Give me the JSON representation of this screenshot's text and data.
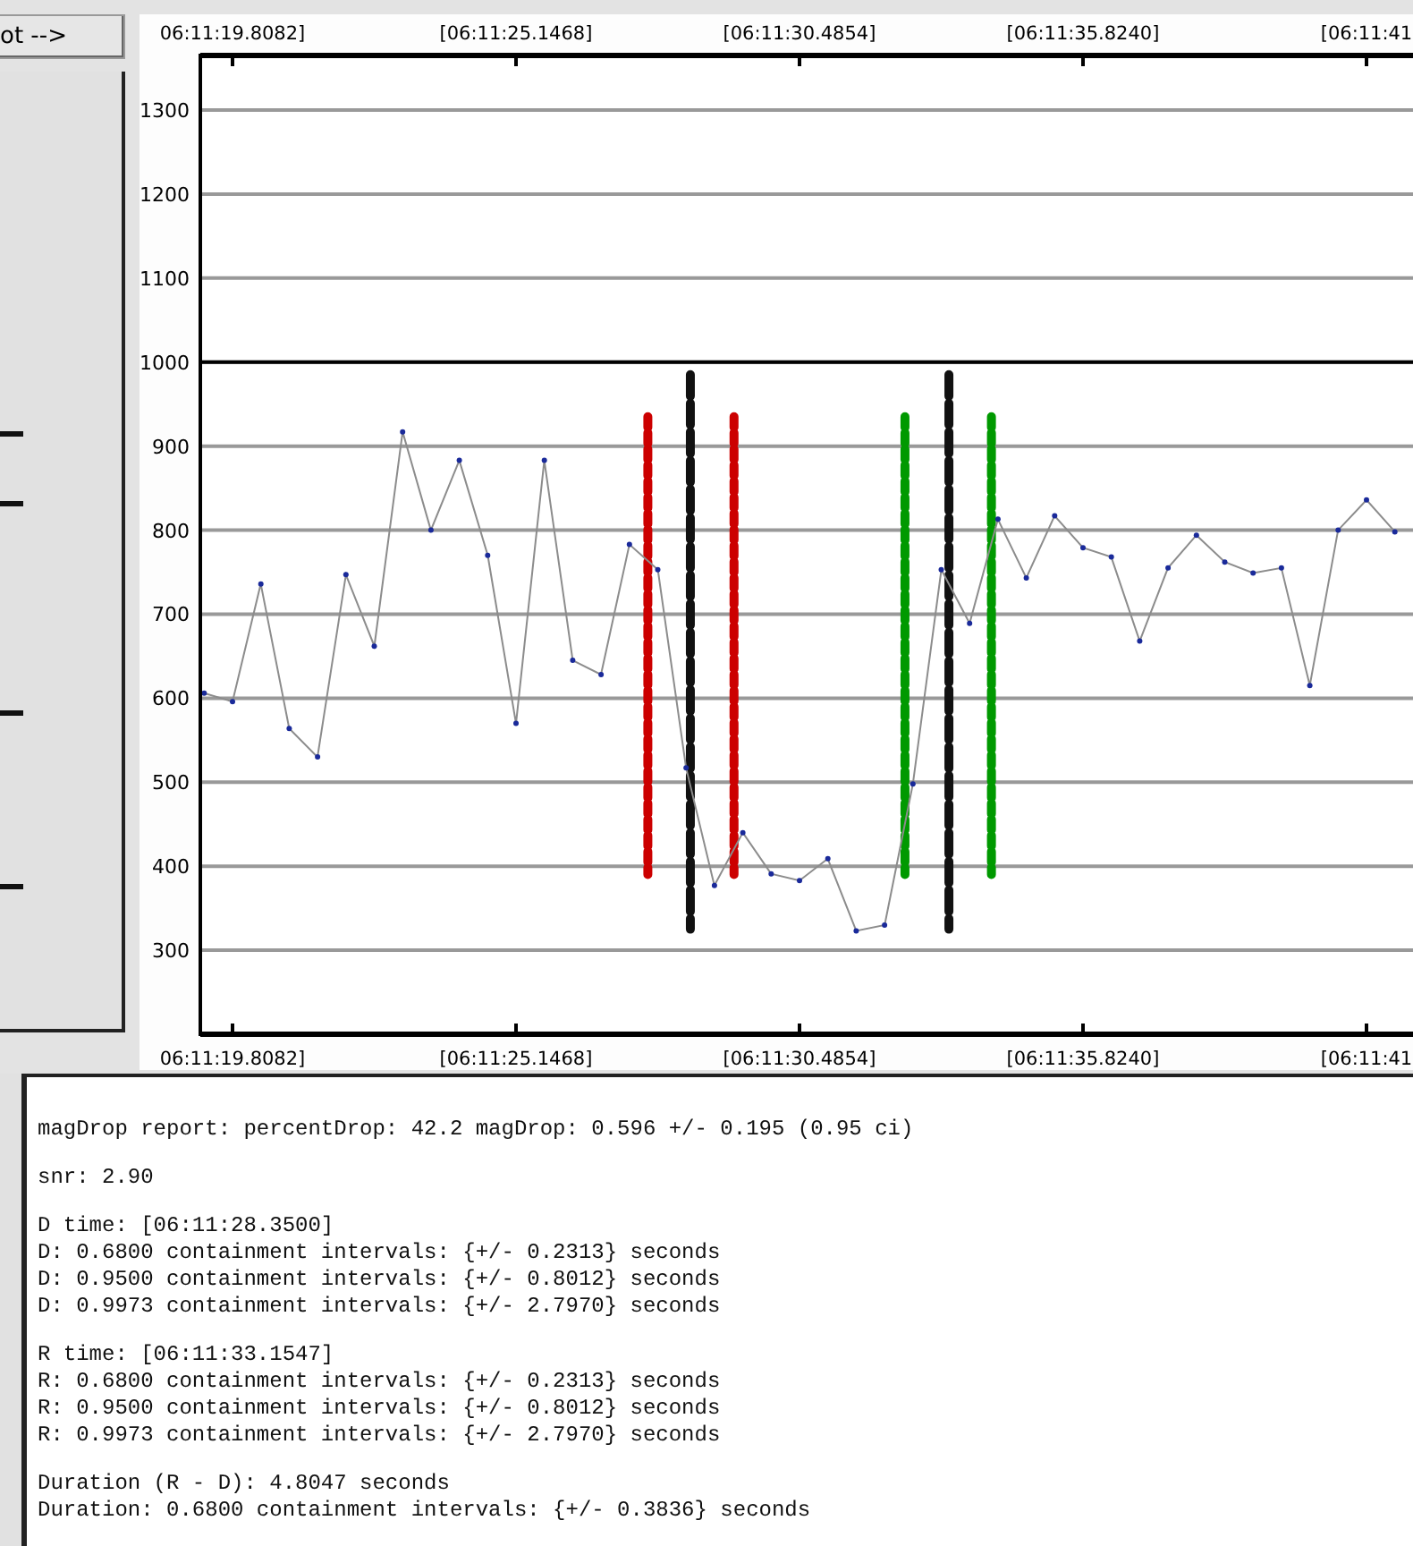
{
  "side_button": {
    "label": "ot -->"
  },
  "chart": {
    "chart_data": {
      "type": "line",
      "categories": [
        null,
        "06:11:19.8082]",
        null,
        null,
        null,
        null,
        null,
        null,
        null,
        null,
        null,
        "[06:11:25.1468]",
        null,
        null,
        null,
        null,
        null,
        null,
        null,
        null,
        null,
        "[06:11:30.4854]",
        null,
        null,
        null,
        null,
        null,
        null,
        null,
        null,
        null,
        "[06:11:35.8240]",
        null,
        null,
        null,
        null,
        null,
        null,
        null,
        null,
        null,
        "[06:11:41",
        null
      ],
      "series": [
        {
          "color": "#8c8c8c",
          "marker": true,
          "values": [
            606,
            596,
            736,
            564,
            530,
            747,
            662,
            917,
            800,
            883,
            770,
            570,
            883,
            645,
            628,
            783,
            753,
            517,
            377,
            440,
            391,
            383,
            409,
            323,
            330,
            498,
            753,
            689,
            813,
            743,
            817,
            779,
            768,
            668,
            755,
            794,
            762,
            749,
            755,
            615,
            800,
            836,
            798
          ]
        }
      ],
      "ylim": [
        200,
        1365
      ],
      "grid": true,
      "yticks": [
        300,
        400,
        500,
        600,
        700,
        800,
        900,
        1000,
        1100,
        1200,
        1300
      ],
      "ref_lines": [
        {
          "axis": "y",
          "value": 1000
        }
      ]
    }
  },
  "report": {
    "paragraphs": [
      [
        "magDrop report: percentDrop: 42.2 magDrop: 0.596 +/- 0.195 (0.95 ci)"
      ],
      [
        "snr: 2.90"
      ],
      [
        "D time: [06:11:28.3500]",
        "D: 0.6800 containment intervals: {+/- 0.2313} seconds",
        "D: 0.9500 containment intervals: {+/- 0.8012} seconds",
        "D: 0.9973 containment intervals: {+/- 2.7970} seconds"
      ],
      [
        "R time: [06:11:33.1547]",
        "R: 0.6800 containment intervals: {+/- 0.2313} seconds",
        "R: 0.9500 containment intervals: {+/- 0.8012} seconds",
        "R: 0.9973 containment intervals: {+/- 2.7970} seconds"
      ],
      [
        "Duration (R - D): 4.8047 seconds",
        "Duration: 0.6800 containment intervals: {+/- 0.3836} seconds"
      ]
    ]
  }
}
